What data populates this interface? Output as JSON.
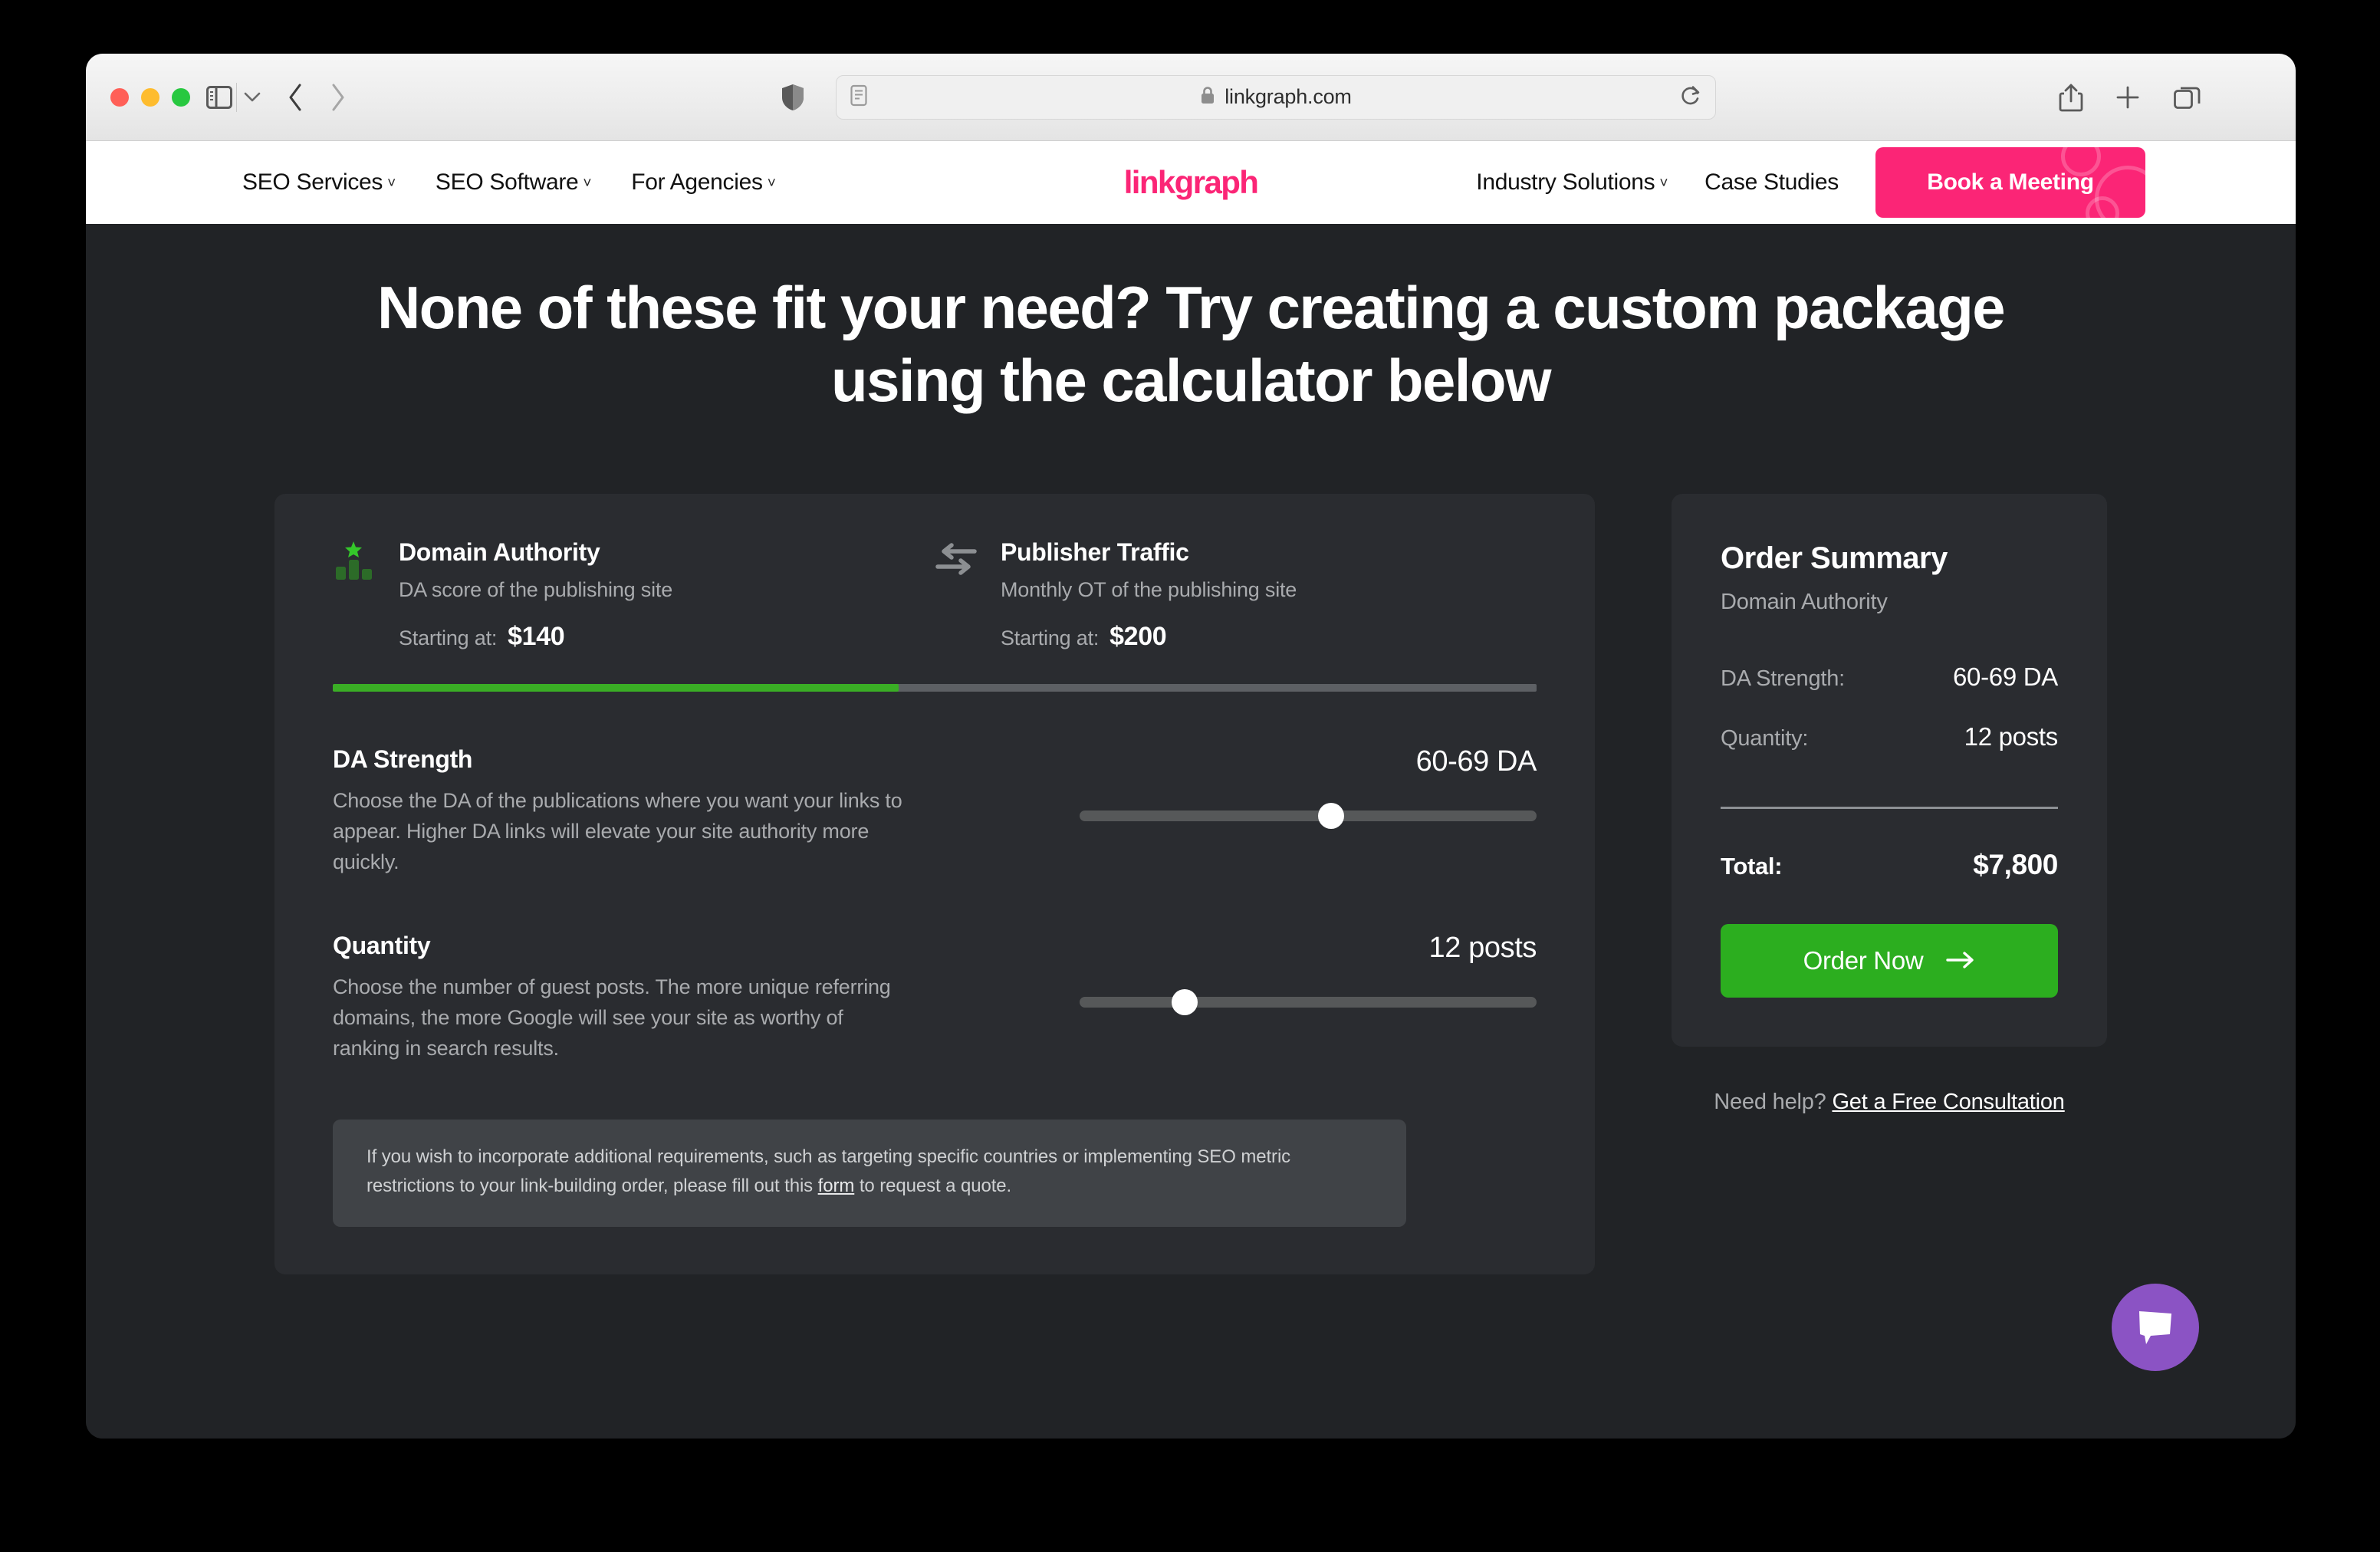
{
  "browser": {
    "url": "linkgraph.com",
    "lock_icon": "lock-icon",
    "reader_icon": "reader-view-icon",
    "shield_icon": "privacy-shield-icon",
    "reload_icon": "reload-icon",
    "back_icon": "back-chevron-icon",
    "forward_icon": "forward-chevron-icon",
    "sidebar_icon": "sidebar-toggle-icon",
    "sidebar_chevron_icon": "chevron-down-icon",
    "share_icon": "share-icon",
    "newtab_icon": "plus-icon",
    "tabs_icon": "tab-overview-icon"
  },
  "site_nav": {
    "logo": "linkgraph",
    "left_links": [
      {
        "label": "SEO Services",
        "has_caret": true
      },
      {
        "label": "SEO Software",
        "has_caret": true
      },
      {
        "label": "For Agencies",
        "has_caret": true
      }
    ],
    "right_links": [
      {
        "label": "Industry Solutions",
        "has_caret": true
      },
      {
        "label": "Case Studies",
        "has_caret": false
      }
    ],
    "cta": "Book a Meeting",
    "cta_color": "#fb2576"
  },
  "hero": {
    "headline": "None of these fit your need? Try creating a custom package using the calculator below"
  },
  "calculator": {
    "tabs": [
      {
        "icon": "bar-chart-star-icon",
        "title": "Domain Authority",
        "subtitle": "DA score of the publishing site",
        "price_label": "Starting at:",
        "price": "$140",
        "active": true
      },
      {
        "icon": "exchange-arrows-icon",
        "title": "Publisher Traffic",
        "subtitle": "Monthly OT of the publishing site",
        "price_label": "Starting at:",
        "price": "$200",
        "active": false
      }
    ],
    "progress_percent": 47,
    "progress_color": "#3aae25",
    "controls": [
      {
        "label": "DA Strength",
        "description": "Choose the DA of the publications where you want your links to appear. Higher DA links will elevate your site authority more quickly.",
        "value": "60-69 DA",
        "slider_percent": 55
      },
      {
        "label": "Quantity",
        "description": "Choose the number of guest posts. The more unique referring domains, the more Google will see your site as worthy of ranking in search results.",
        "value": "12  posts",
        "slider_percent": 23
      }
    ],
    "note": {
      "before": "If you wish to incorporate additional requirements, such as targeting specific countries or implementing SEO metric restrictions to your link-building order, please fill out this ",
      "link": "form",
      "after": " to request a quote."
    }
  },
  "order_summary": {
    "title": "Order Summary",
    "subtitle": "Domain Authority",
    "rows": [
      {
        "key": "DA Strength:",
        "value": "60-69 DA"
      },
      {
        "key": "Quantity:",
        "value": "12 posts"
      }
    ],
    "total_key": "Total:",
    "total_value": "$7,800",
    "order_button": "Order Now",
    "order_button_color": "#2cae1f",
    "order_arrow_icon": "arrow-right-icon"
  },
  "help": {
    "prefix": "Need help? ",
    "link": "Get a Free Consultation"
  },
  "chat": {
    "icon": "chat-bubble-icon",
    "color": "#8b53c4"
  }
}
